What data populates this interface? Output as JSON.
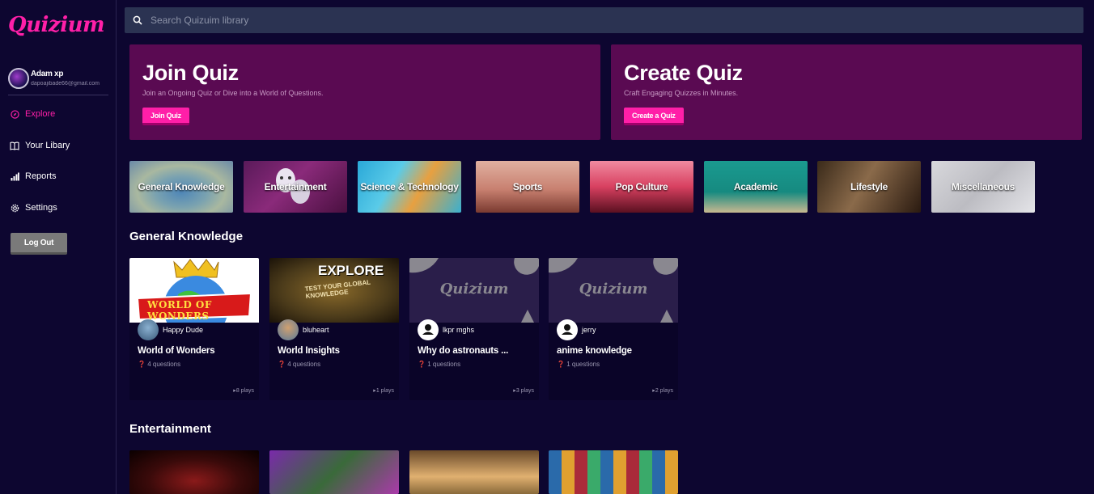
{
  "app": {
    "logo": "Quizium"
  },
  "profile": {
    "name": "Adam xp",
    "email": "dapoajibade66@gmail.com"
  },
  "nav": {
    "explore": "Explore",
    "library": "Your Libary",
    "reports": "Reports",
    "settings": "Settings"
  },
  "logout_label": "Log Out",
  "search": {
    "placeholder": "Search Quizuim library"
  },
  "hero": {
    "join": {
      "title": "Join Quiz",
      "subtitle": "Join an Ongoing Quiz or Dive into a World of Questions.",
      "button": "Join Quiz"
    },
    "create": {
      "title": "Create Quiz",
      "subtitle": "Craft Engaging Quizzes in Minutes.",
      "button": "Create a Quiz"
    }
  },
  "categories": [
    {
      "label": "General Knowledge"
    },
    {
      "label": "Entertainment"
    },
    {
      "label": "Science & Technology"
    },
    {
      "label": "Sports"
    },
    {
      "label": "Pop Culture"
    },
    {
      "label": "Academic"
    },
    {
      "label": "Lifestyle"
    },
    {
      "label": "Miscellaneous"
    }
  ],
  "sections": {
    "general": {
      "title": "General Knowledge",
      "quizzes": [
        {
          "author": "Happy Dude",
          "title": "World of Wonders",
          "questions": "4 questions",
          "plays": "8 plays",
          "thumb_text": "WORLD OF WONDERS"
        },
        {
          "author": "bluheart",
          "title": "World Insights",
          "questions": "4 questions",
          "plays": "1 plays",
          "thumb_text": "EXPLORE",
          "thumb_sub": "TEST YOUR GLOBAL KNOWLEDGE"
        },
        {
          "author": "lkpr mghs",
          "title": "Why do astronauts ...",
          "questions": "1 questions",
          "plays": "3 plays",
          "thumb_text": "Quizium"
        },
        {
          "author": "jerry",
          "title": "anime knowledge",
          "questions": "1 questions",
          "plays": "2 plays",
          "thumb_text": "Quizium"
        }
      ]
    },
    "entertainment": {
      "title": "Entertainment"
    }
  },
  "colors": {
    "accent": "#ff1fa8",
    "background": "#0d0630",
    "hero": "#5a0a52",
    "search": "#2b3352"
  }
}
